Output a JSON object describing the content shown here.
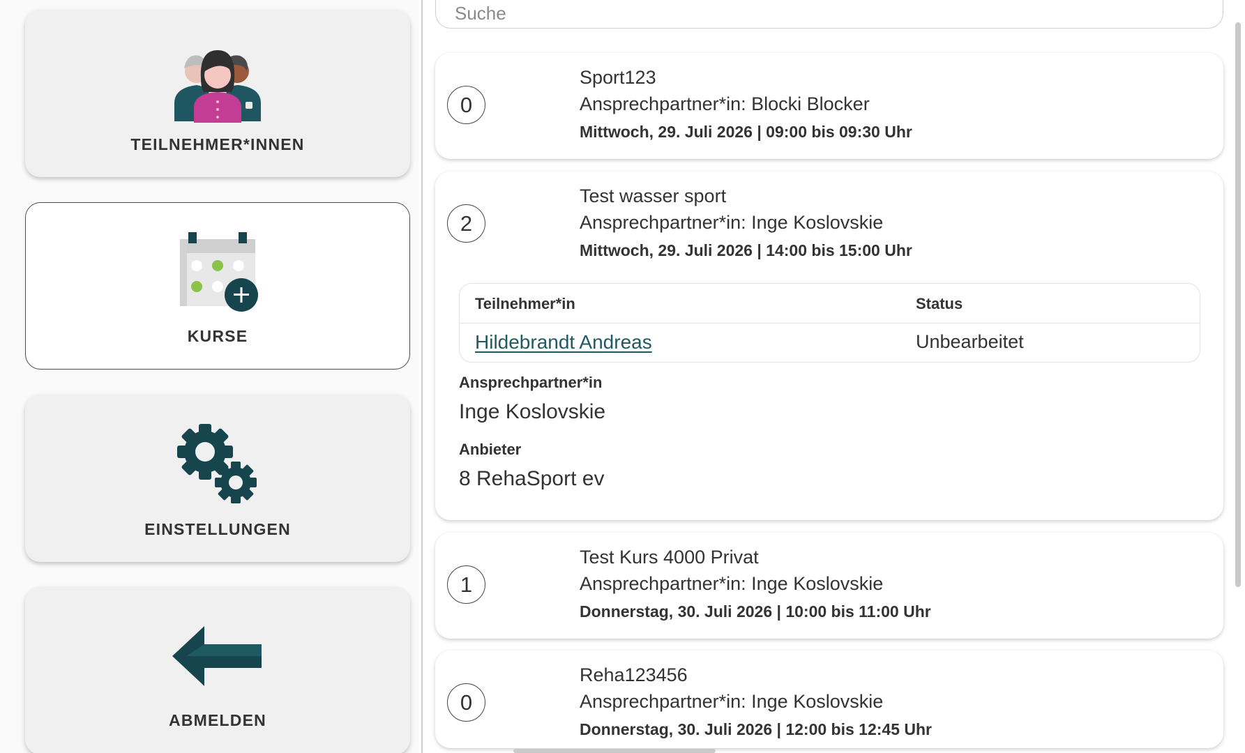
{
  "nav": {
    "participants_label": "TEILNEHMER*INNEN",
    "courses_label": "KURSE",
    "settings_label": "EINSTELLUNGEN",
    "logout_label": "ABMELDEN"
  },
  "search": {
    "placeholder": "Suche"
  },
  "courses": [
    {
      "count": "0",
      "title": "Sport123",
      "contact": "Ansprechpartner*in: Blocki Blocker",
      "date": "Mittwoch, 29. Juli 2026 | 09:00 bis 09:30 Uhr"
    },
    {
      "count": "2",
      "title": "Test wasser sport",
      "contact": "Ansprechpartner*in: Inge Koslovskie",
      "date": "Mittwoch, 29. Juli 2026 | 14:00 bis 15:00 Uhr",
      "table": {
        "col_participant": "Teilnehmer*in",
        "col_status": "Status",
        "rows": [
          {
            "name": "Hildebrandt Andreas",
            "status": "Unbearbeitet"
          }
        ]
      },
      "contact_label": "Ansprechpartner*in",
      "contact_value": "Inge Koslovskie",
      "provider_label": "Anbieter",
      "provider_value": "8 RehaSport ev"
    },
    {
      "count": "1",
      "title": "Test Kurs 4000 Privat",
      "contact": "Ansprechpartner*in: Inge Koslovskie",
      "date": "Donnerstag, 30. Juli 2026 | 10:00 bis 11:00 Uhr"
    },
    {
      "count": "0",
      "title": "Reha123456",
      "contact": "Ansprechpartner*in: Inge Koslovskie",
      "date": "Donnerstag, 30. Juli 2026 | 12:00 bis 12:45 Uhr"
    }
  ],
  "colors": {
    "accent_dark": "#17454e",
    "link": "#1f5a63",
    "magenta": "#c23d93",
    "green": "#8bc34a"
  }
}
